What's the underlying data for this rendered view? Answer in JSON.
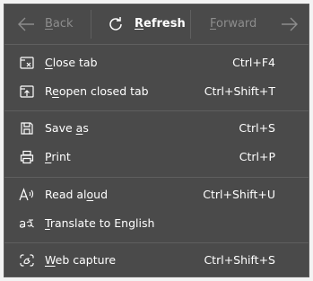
{
  "nav": {
    "back": {
      "label": "Back",
      "hotkey": "B",
      "rest": "ack",
      "enabled": false
    },
    "refresh": {
      "label": "Refresh",
      "hotkey": "R",
      "rest": "efresh"
    },
    "forward": {
      "label": "Forward",
      "hotkey": "F",
      "rest": "orward",
      "enabled": false
    }
  },
  "items": [
    {
      "icon": "close-tab-icon",
      "pre": "",
      "hotkey": "C",
      "post": "lose tab",
      "shortcut": "Ctrl+F4"
    },
    {
      "icon": "reopen-tab-icon",
      "pre": "R",
      "hotkey": "e",
      "post": "open closed tab",
      "shortcut": "Ctrl+Shift+T"
    },
    {
      "icon": "save-icon",
      "pre": "Save ",
      "hotkey": "a",
      "post": "s",
      "shortcut": "Ctrl+S"
    },
    {
      "icon": "print-icon",
      "pre": "",
      "hotkey": "P",
      "post": "rint",
      "shortcut": "Ctrl+P"
    },
    {
      "icon": "read-aloud-icon",
      "pre": "Read al",
      "hotkey": "o",
      "post": "ud",
      "shortcut": "Ctrl+Shift+U"
    },
    {
      "icon": "translate-icon",
      "pre": "",
      "hotkey": "T",
      "post": "ranslate to English",
      "shortcut": ""
    },
    {
      "icon": "web-capture-icon",
      "pre": "",
      "hotkey": "W",
      "post": "eb capture",
      "shortcut": "Ctrl+Shift+S"
    }
  ],
  "colors": {
    "menu_background": "#4a4a4a",
    "separator": "#5f5f5f",
    "text": "#ffffff",
    "disabled_text": "#8d8d8d"
  }
}
